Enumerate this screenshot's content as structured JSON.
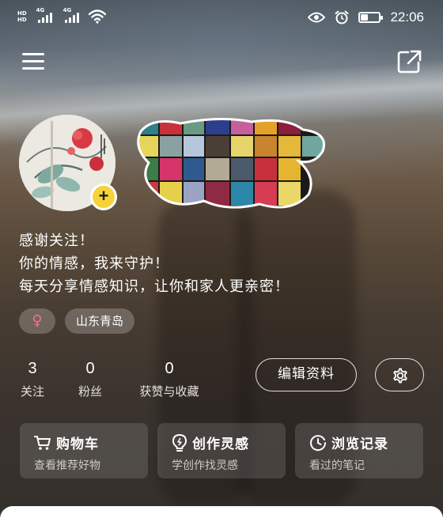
{
  "status_bar": {
    "hd_label": "HD",
    "network_1": "4G",
    "network_2": "4G",
    "time": "22:06",
    "icons": [
      "eye-icon",
      "alarm-icon",
      "battery-icon",
      "wifi-icon",
      "signal-icon"
    ]
  },
  "nav": {
    "menu_icon": "hamburger-menu-icon",
    "share_icon": "share-external-icon"
  },
  "profile": {
    "avatar_badge": "+",
    "bio_lines": [
      "感谢关注！",
      "你的情感，我来守护！",
      "每天分享情感知识，让你和家人更亲密！"
    ],
    "gender_symbol": "♀",
    "location": "山东青岛"
  },
  "stats": [
    {
      "value": "3",
      "label": "关注"
    },
    {
      "value": "0",
      "label": "粉丝"
    },
    {
      "value": "0",
      "label": "获赞与收藏"
    }
  ],
  "actions": {
    "edit_label": "编辑资料",
    "settings_icon": "gear-icon"
  },
  "cards": [
    {
      "title": "购物车",
      "subtitle": "查看推荐好物",
      "icon": "cart-icon"
    },
    {
      "title": "创作灵感",
      "subtitle": "学创作找灵感",
      "icon": "lightbulb-icon"
    },
    {
      "title": "浏览记录",
      "subtitle": "看过的笔记",
      "icon": "clock-icon"
    }
  ],
  "colors": {
    "accent_yellow": "#f5d33b",
    "gender_pink": "#ff6b86"
  }
}
